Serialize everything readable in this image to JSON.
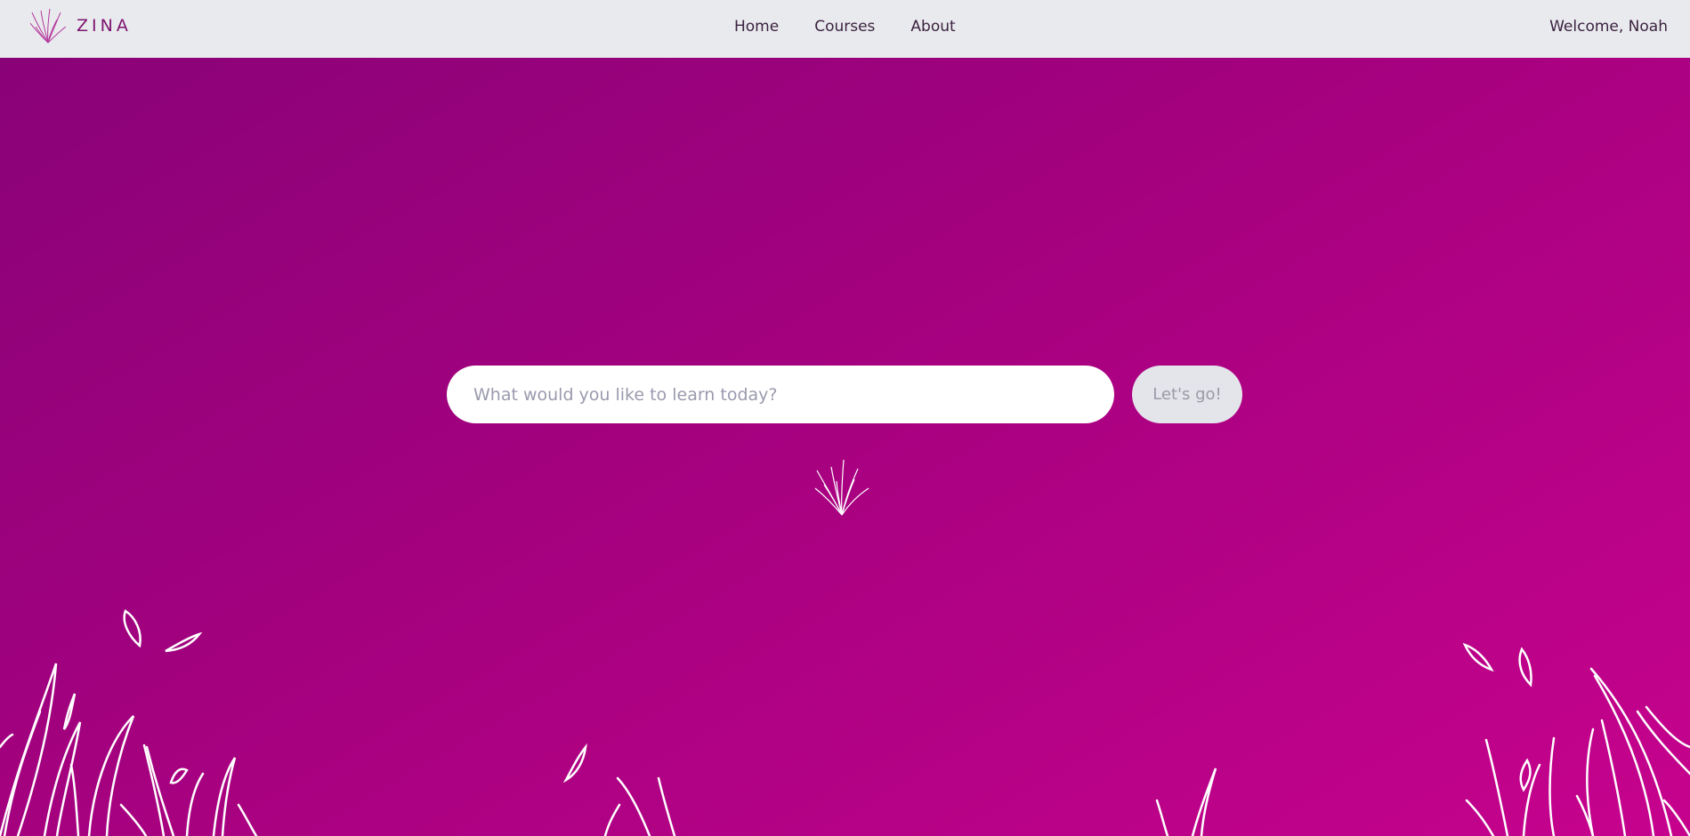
{
  "header": {
    "brand": "ZINA",
    "brand_icon": "grass-tuft-icon",
    "nav": [
      {
        "label": "Home"
      },
      {
        "label": "Courses"
      },
      {
        "label": "About"
      }
    ],
    "welcome": "Welcome, Noah"
  },
  "search": {
    "placeholder": "What would you like to learn today?",
    "value": "",
    "button_label": "Let's go!"
  },
  "colors": {
    "header_bg": "#e9eaed",
    "brand": "#7d1270",
    "gradient_start": "#8a0278",
    "gradient_end": "#c6028d"
  }
}
